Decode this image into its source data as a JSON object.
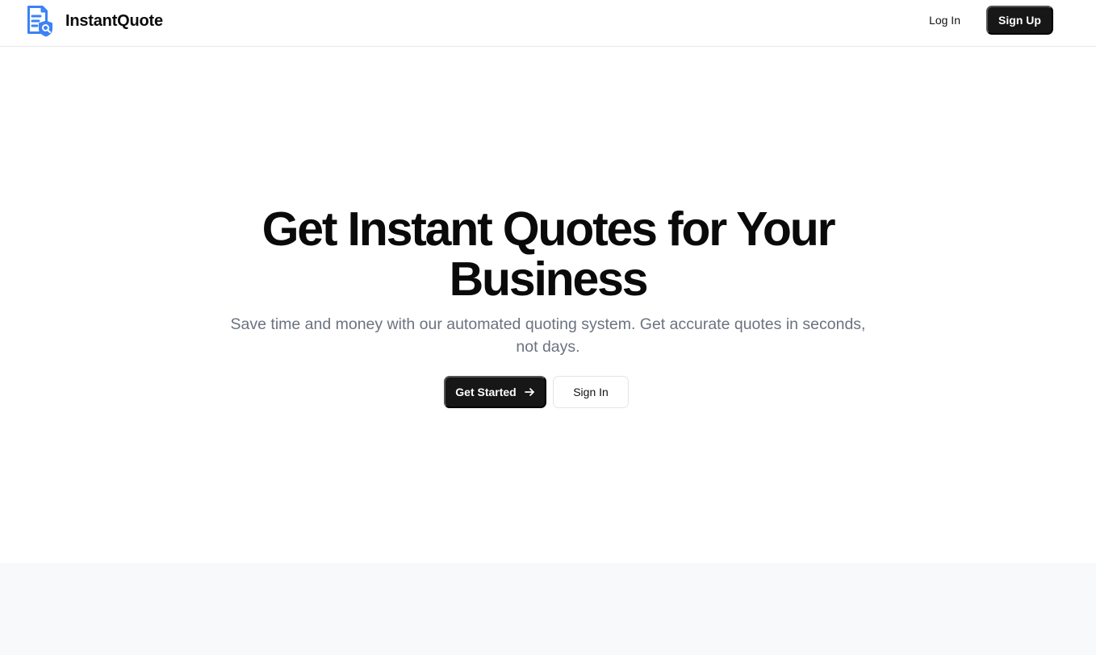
{
  "header": {
    "brand_name": "InstantQuote",
    "logo_icon": "document-search-icon",
    "login_label": "Log In",
    "signup_label": "Sign Up"
  },
  "hero": {
    "title": "Get Instant Quotes for Your Business",
    "subtitle": "Save time and money with our automated quoting system. Get accurate quotes in seconds, not days.",
    "primary_cta_label": "Get Started",
    "primary_cta_icon": "arrow-right-icon",
    "secondary_cta_label": "Sign In"
  },
  "colors": {
    "accent_blue": "#3b82f6",
    "dark_button": "#171717",
    "muted_text": "#6b7280",
    "section_background": "#f8f9fb"
  }
}
